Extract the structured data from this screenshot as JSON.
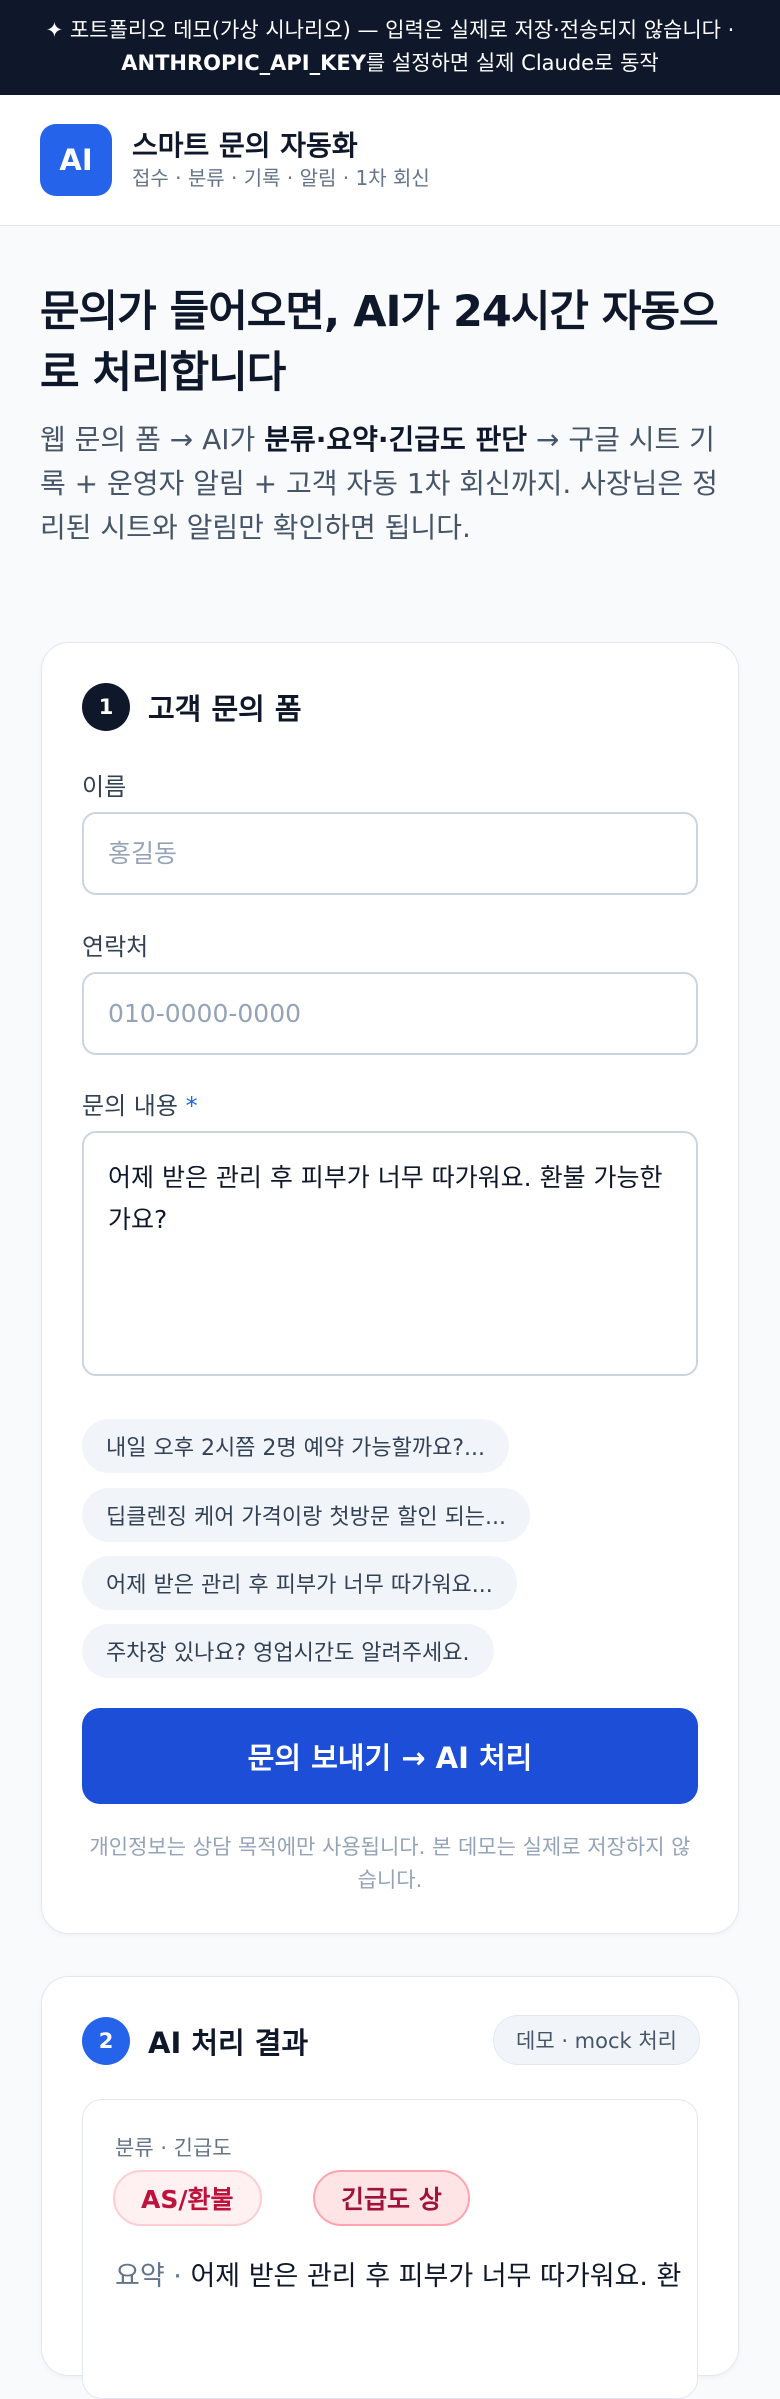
{
  "banner": {
    "line1": "✦ 포트폴리오 데모(가상 시나리오) — 입력은 실제로 저장·전송되지 않습니다 ·",
    "line2_bold": "ANTHROPIC_API_KEY",
    "line2_rest": "를 설정하면 실제 Claude로 동작"
  },
  "header": {
    "logo_text": "AI",
    "title": "스마트 문의 자동화",
    "subtitle": "접수 · 분류 · 기록 · 알림 · 1차 회신"
  },
  "hero": {
    "title": "문의가 들어오면, AI가 24시간 자동으로 처리합니다",
    "desc_part1": "웹 문의 폼 → AI가 ",
    "desc_bold": "분류·요약·긴급도 판단",
    "desc_part2": " → 구글 시트 기록 + 운영자 알림 + 고객 자동 1차 회신까지. 사장님은 정리된 시트와 알림만 확인하면 됩니다."
  },
  "form": {
    "step": "1",
    "title": "고객 문의 폼",
    "name_label": "이름",
    "name_placeholder": "홍길동",
    "phone_label": "연락처",
    "phone_placeholder": "010-0000-0000",
    "message_label": "문의 내용",
    "required_mark": "*",
    "message_value": "어제 받은 관리 후 피부가 너무 따가워요. 환불 가능한가요?",
    "samples": [
      "내일 오후 2시쯤 2명 예약 가능할까요?...",
      "딥클렌징 케어 가격이랑 첫방문 할인 되는...",
      "어제 받은 관리 후 피부가 너무 따가워요...",
      "주차장 있나요? 영업시간도 알려주세요."
    ],
    "submit_label": "문의 보내기 → AI 처리",
    "privacy_note": "개인정보는 상담 목적에만 사용됩니다. 본 데모는 실제로 저장하지 않습니다."
  },
  "result": {
    "step": "2",
    "title": "AI 처리 결과",
    "mode_badge": "데모 · mock 처리",
    "meta_label": "분류 · 긴급도",
    "category": "AS/환불",
    "urgency": "긴급도 상",
    "summary_key": "요약",
    "summary_sep": " · ",
    "summary_text": "어제 받은 관리 후 피부가 너무 따가워요. 환"
  },
  "colors": {
    "banner_bg": "#0f172a",
    "accent": "#2563eb",
    "submit_bg": "#1d4ed8",
    "category_text": "#be123c"
  }
}
